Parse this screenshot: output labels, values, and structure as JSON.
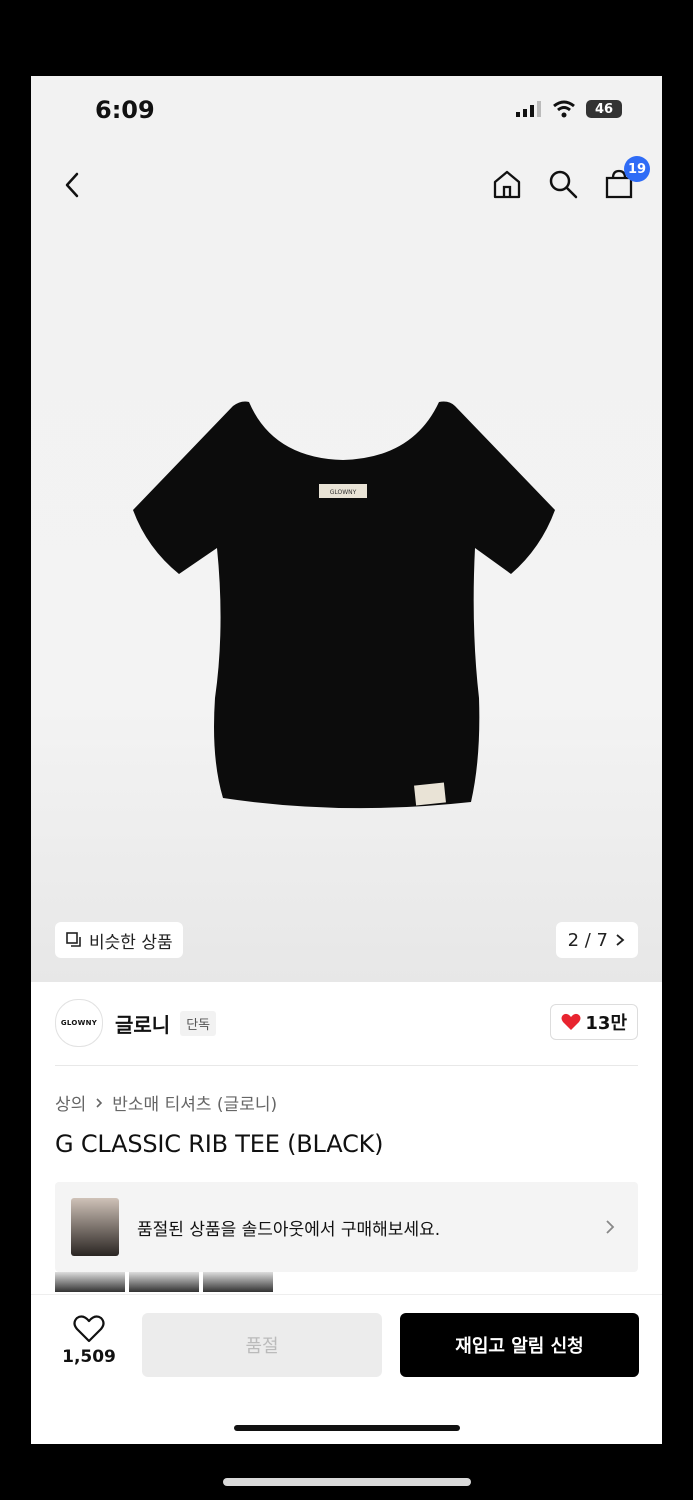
{
  "status": {
    "time": "6:09",
    "battery": "46"
  },
  "nav": {
    "cart_count": "19"
  },
  "gallery": {
    "similar_label": "비슷한 상품",
    "pager": "2 / 7"
  },
  "brand": {
    "logo_text": "GLOWNY",
    "name": "글로니",
    "tag": "단독",
    "likes": "13만"
  },
  "breadcrumb": {
    "category": "상의",
    "subcategory": "반소매 티셔츠 (글로니)"
  },
  "product": {
    "title": "G CLASSIC RIB TEE (BLACK)",
    "label_text": "GLOWNY"
  },
  "banner": {
    "text": "품절된 상품을 솔드아웃에서 구매해보세요."
  },
  "bottom": {
    "wish_count": "1,509",
    "soldout_label": "품절",
    "restock_label": "재입고 알림 신청"
  },
  "colors": {
    "accent_blue": "#2f6cf6",
    "heart_red": "#e8242f",
    "primary": "#000000"
  }
}
